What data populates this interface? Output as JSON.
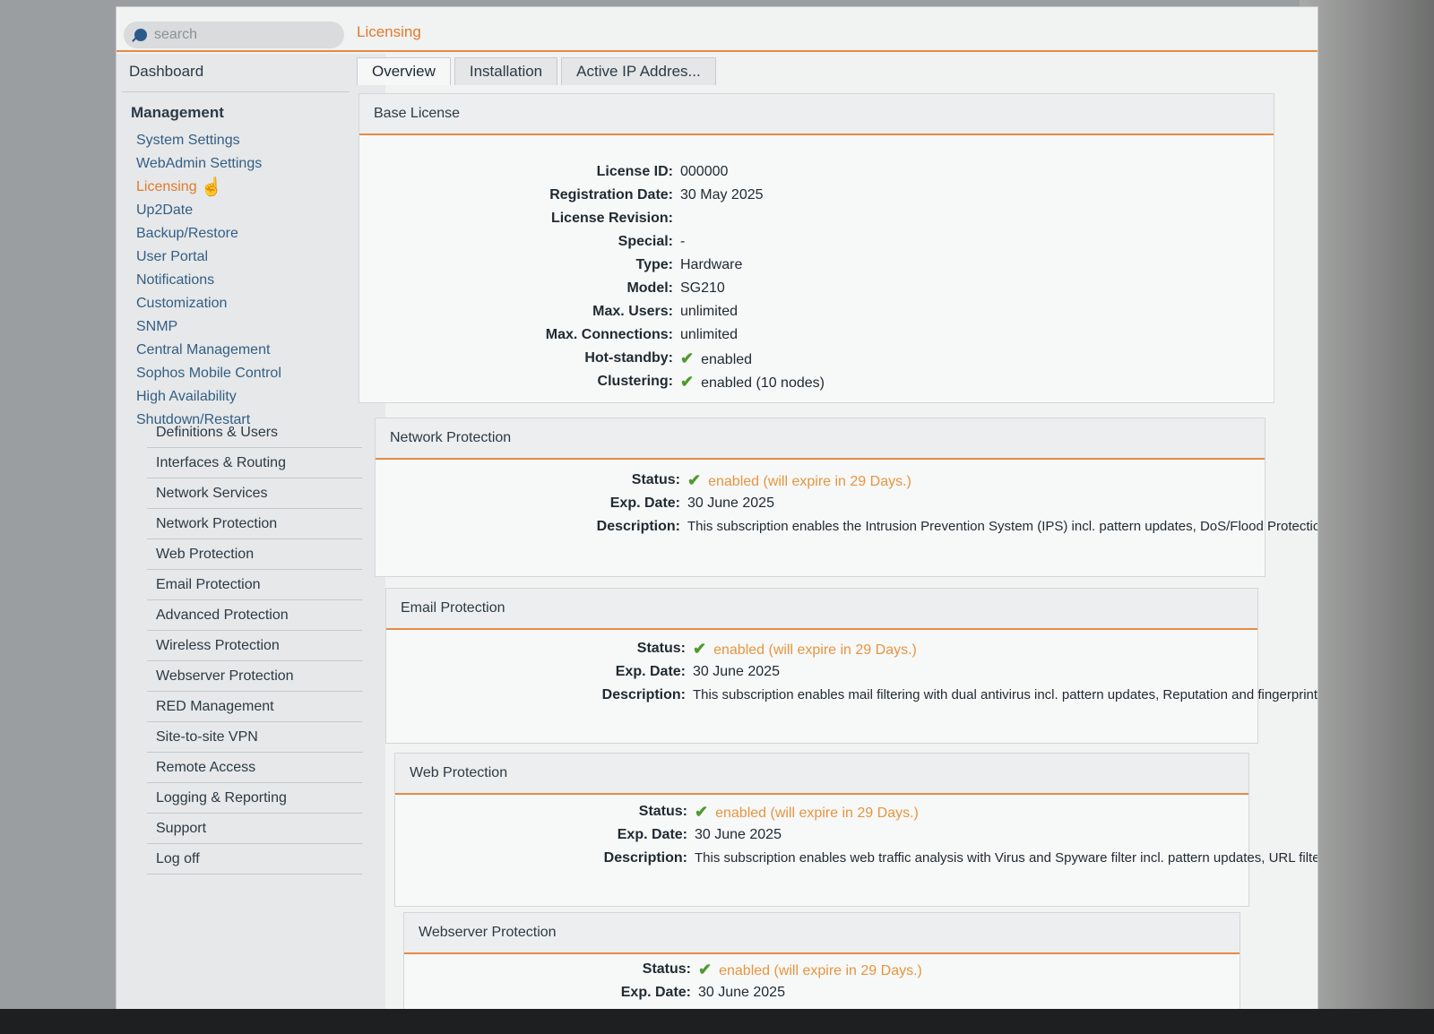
{
  "search": {
    "placeholder": "search"
  },
  "page_heading": "Licensing",
  "sidebar": {
    "dashboard": "Dashboard",
    "management_heading": "Management",
    "management_items": [
      "System Settings",
      "WebAdmin Settings",
      "Licensing",
      "Up2Date",
      "Backup/Restore",
      "User Portal",
      "Notifications",
      "Customization",
      "SNMP",
      "Central Management",
      "Sophos Mobile Control",
      "High Availability",
      "Shutdown/Restart"
    ],
    "categories": [
      "Definitions & Users",
      "Interfaces & Routing",
      "Network Services",
      "Network Protection",
      "Web Protection",
      "Email Protection",
      "Advanced Protection",
      "Wireless Protection",
      "Webserver Protection",
      "RED Management",
      "Site-to-site VPN",
      "Remote Access",
      "Logging & Reporting",
      "Support",
      "Log off"
    ]
  },
  "tabs": [
    "Overview",
    "Installation",
    "Active IP Addres..."
  ],
  "base_license": {
    "title": "Base License",
    "rows": [
      {
        "label": "License ID:",
        "value": "000000"
      },
      {
        "label": "Registration Date:",
        "value": "30 May 2025"
      },
      {
        "label": "License Revision:",
        "value": ""
      },
      {
        "label": "Special:",
        "value": "-"
      },
      {
        "label": "Type:",
        "value": "Hardware"
      },
      {
        "label": "Model:",
        "value": "SG210"
      },
      {
        "label": "Max. Users:",
        "value": "unlimited"
      },
      {
        "label": "Max. Connections:",
        "value": "unlimited"
      },
      {
        "label": "Hot-standby:",
        "value": "enabled"
      },
      {
        "label": "Clustering:",
        "value": "enabled (10 nodes)"
      }
    ]
  },
  "labels": {
    "status": "Status:",
    "exp_date": "Exp. Date:",
    "description": "Description:"
  },
  "subscriptions": [
    {
      "title": "Network Protection",
      "status": "enabled (will expire in 29 Days.)",
      "exp_date": "30 June 2025",
      "description": "This subscription enables the Intrusion Prevention System (IPS) incl. pattern updates, DoS/Flood Protection, SSL & IPsec based VPN and Remote Access, Advanced Routing, WAN Link Balancing and detailed Network Protection Reporting."
    },
    {
      "title": "Email Protection",
      "status": "enabled (will expire in 29 Days.)",
      "exp_date": "30 June 2025",
      "description": "This subscription enables mail filtering with dual antivirus incl. pattern updates, Reputation and fingerprint based spam filtering, transparent Email Encryption (OpenPGP & S/MIME), End-User Quarantine Management and detailed Mail Usage Reporting."
    },
    {
      "title": "Web Protection",
      "status": "enabled (will expire in 29 Days.)",
      "exp_date": "30 June 2025",
      "description": "This subscription enables web traffic analysis with Virus and Spyware filter incl. pattern updates, URL filter by category, AD/eDir SSO Authentication, HTTPS filtering, Application Control and detailed Web Usage Reporting."
    },
    {
      "title": "Webserver Protection",
      "status": "enabled (will expire in 29 Days.)",
      "exp_date": "30 June 2025"
    }
  ],
  "colors": {
    "accent": "#e58a45",
    "link": "#335e85",
    "check": "#4f9a2e"
  }
}
